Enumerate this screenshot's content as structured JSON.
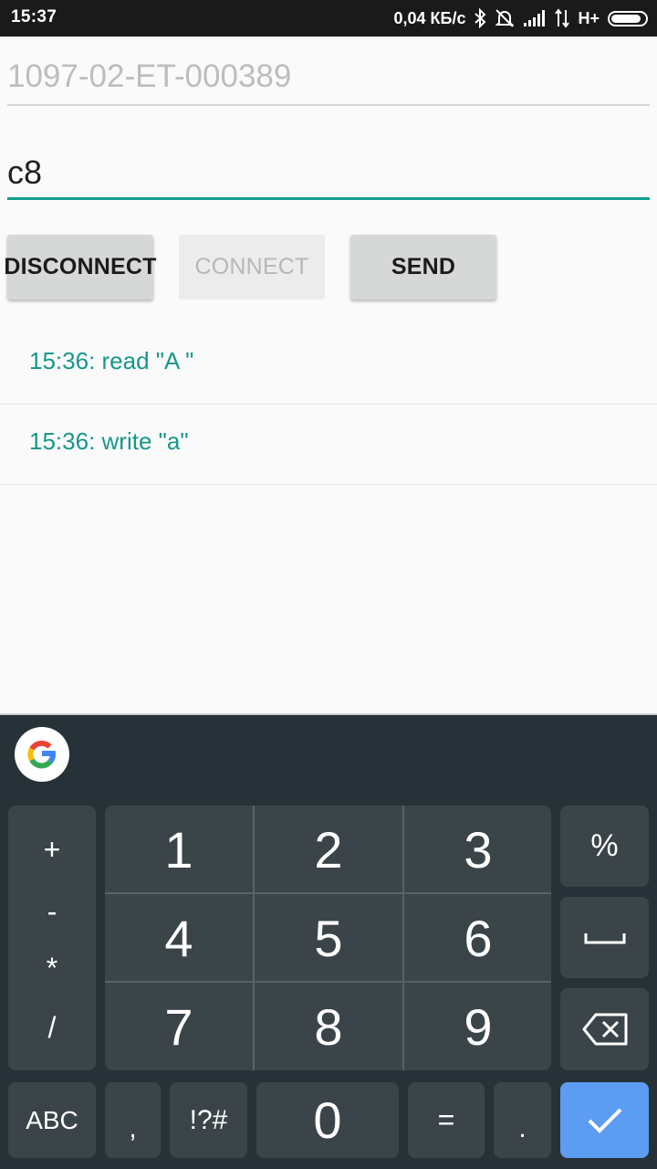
{
  "status_bar": {
    "time": "15:37",
    "speed": "0,04 КБ/с",
    "network_type": "H+",
    "icons": [
      "bluetooth-icon",
      "bell-muted-icon",
      "signal-icon",
      "data-arrows-icon",
      "battery-icon"
    ]
  },
  "form": {
    "device_id_placeholder": "1097-02-ET-000389",
    "message_value": "c8"
  },
  "buttons": {
    "disconnect": "DISCONNECT",
    "connect": "CONNECT",
    "send": "SEND"
  },
  "log": [
    {
      "text": "15:36: read \"A \""
    },
    {
      "text": "15:36: write \"a\""
    }
  ],
  "keyboard": {
    "symbols": [
      "+",
      "-",
      "*",
      "/"
    ],
    "digits": [
      "1",
      "2",
      "3",
      "4",
      "5",
      "6",
      "7",
      "8",
      "9"
    ],
    "percent": "%",
    "abc": "ABC",
    "comma": ",",
    "special": "!?#",
    "zero": "0",
    "equals": "=",
    "period": "."
  },
  "colors": {
    "accent": "#129e8d",
    "keyboard_bg": "#263238",
    "key_bg": "#3b4448",
    "done_key": "#5c9cf2"
  }
}
